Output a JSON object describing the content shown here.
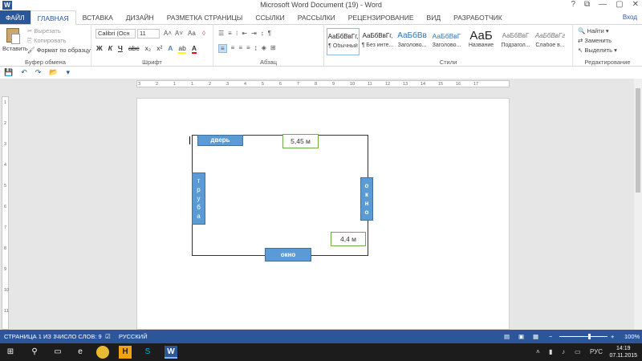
{
  "window": {
    "title": "Microsoft Word Document (19) - Word",
    "controls": [
      "?",
      "⧉",
      "—",
      "▢",
      "✕"
    ],
    "signin": "Вход"
  },
  "tabs": [
    "ФАЙЛ",
    "ГЛАВНАЯ",
    "ВСТАВКА",
    "ДИЗАЙН",
    "РАЗМЕТКА СТРАНИЦЫ",
    "ССЫЛКИ",
    "РАССЫЛКИ",
    "РЕЦЕНЗИРОВАНИЕ",
    "ВИД",
    "РАЗРАБОТЧИК"
  ],
  "clipboard": {
    "paste": "Вставить",
    "cut": "Вырезать",
    "copy": "Копировать",
    "format_painter": "Формат по образцу",
    "label": "Буфер обмена"
  },
  "font": {
    "name": "Calibri (Осн",
    "size": "11",
    "label": "Шрифт",
    "format_buttons": [
      "Ж",
      "К",
      "Ч",
      "abc",
      "x₂",
      "x²"
    ]
  },
  "paragraph": {
    "label": "Абзац"
  },
  "styles": {
    "label": "Стили",
    "items": [
      {
        "sample": "АаБбВвГг,",
        "name": "¶ Обычный"
      },
      {
        "sample": "АаБбВвГг,",
        "name": "¶ Без инте..."
      },
      {
        "sample": "АаБбВв",
        "name": "Заголово..."
      },
      {
        "sample": "АаБбВвГ",
        "name": "Заголово..."
      },
      {
        "sample": "АаБ",
        "name": "Название"
      },
      {
        "sample": "АаБбВвГ",
        "name": "Подзагол..."
      },
      {
        "sample": "АаБбВвГг",
        "name": "Слабое в..."
      }
    ]
  },
  "editing": {
    "find": "Найти",
    "replace": "Заменить",
    "select": "Выделить",
    "label": "Редактирование"
  },
  "ruler": {
    "h_numbers": [
      "3",
      "2",
      "1",
      "1",
      "2",
      "3",
      "4",
      "5",
      "6",
      "7",
      "8",
      "9",
      "10",
      "11",
      "12",
      "13",
      "14",
      "15",
      "16",
      "17"
    ],
    "v_numbers": [
      "1",
      "2",
      "3",
      "4",
      "5",
      "6",
      "7",
      "8",
      "9",
      "10",
      "11"
    ]
  },
  "plan": {
    "door": "дверь",
    "pipe": "т р у б а",
    "window_right": "о к н о",
    "window_bottom": "окно",
    "width_label": "5,45 м",
    "height_label": "4,4 м"
  },
  "status": {
    "page": "СТРАНИЦА 1 ИЗ 1",
    "words": "ЧИСЛО СЛОВ: 9",
    "lang": "РУССКИЙ",
    "zoom": "100%",
    "zoom_value": 100
  },
  "taskbar": {
    "time": "14:19",
    "date": "07.11.2015",
    "lang": "РУС"
  }
}
